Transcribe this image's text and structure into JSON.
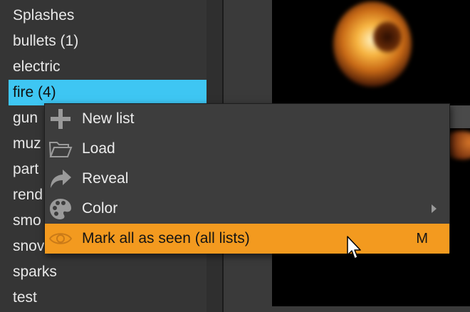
{
  "sidebar": {
    "items": [
      {
        "label": "Splashes",
        "selected": false
      },
      {
        "label": "bullets (1)",
        "selected": false
      },
      {
        "label": "electric",
        "selected": false
      },
      {
        "label": "fire (4)",
        "selected": true
      },
      {
        "label": "gun",
        "selected": false
      },
      {
        "label": "muz",
        "selected": false
      },
      {
        "label": "part",
        "selected": false
      },
      {
        "label": "rend",
        "selected": false
      },
      {
        "label": "smo",
        "selected": false
      },
      {
        "label": "snov",
        "selected": false
      },
      {
        "label": "sparks",
        "selected": false
      },
      {
        "label": "test",
        "selected": false
      }
    ]
  },
  "context_menu": {
    "items": [
      {
        "label": "New list",
        "icon": "plus-icon"
      },
      {
        "label": "Load",
        "icon": "folder-icon"
      },
      {
        "label": "Reveal",
        "icon": "arrow-forward-icon"
      },
      {
        "label": "Color",
        "icon": "palette-icon",
        "has_submenu": true
      },
      {
        "label": "Mark all as seen (all lists)",
        "icon": "eye-icon",
        "shortcut": "M",
        "highlighted": true
      }
    ]
  },
  "colors": {
    "selection": "#3ec6f3",
    "menu_highlight": "#f39a1f",
    "panel_bg": "#353535",
    "menu_bg": "#3d3d3d"
  }
}
